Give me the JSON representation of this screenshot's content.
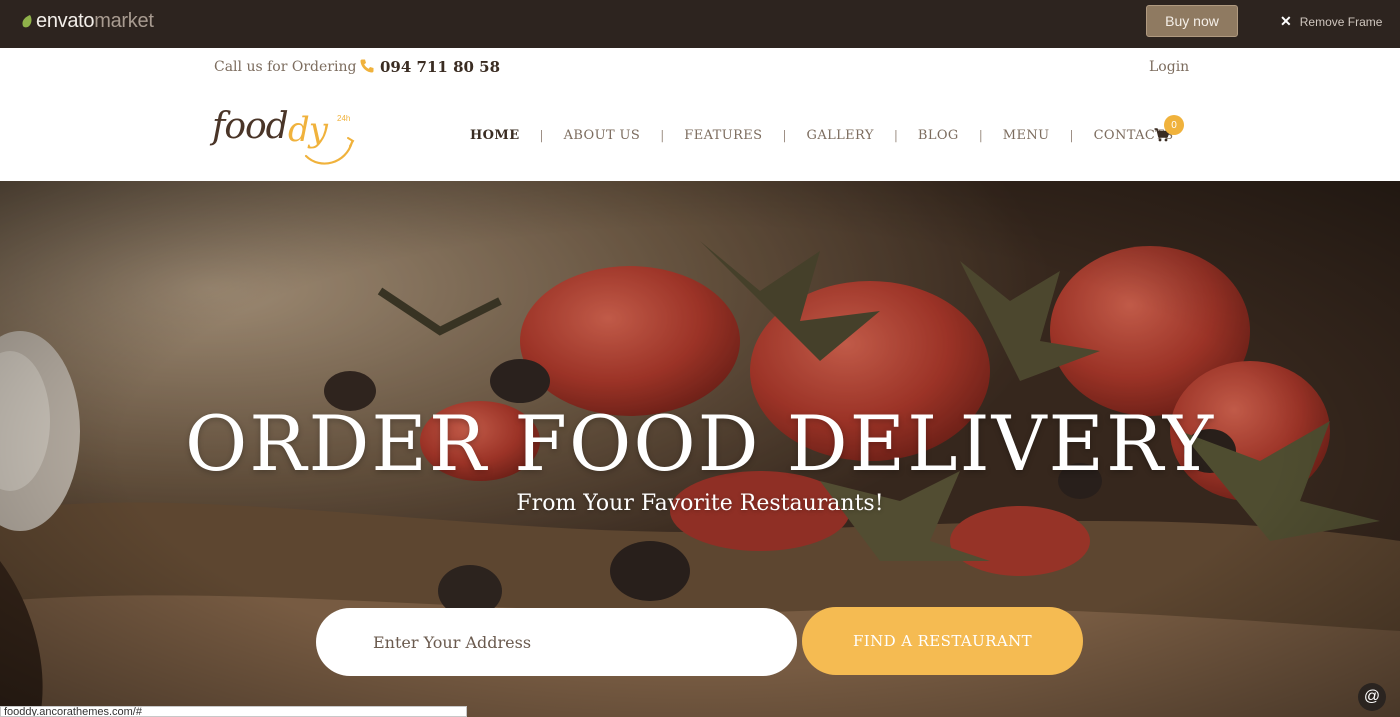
{
  "envato": {
    "brand_primary": "envato",
    "brand_secondary": "market",
    "buy_label": "Buy now",
    "remove_frame_label": "Remove Frame"
  },
  "contact": {
    "call_label": "Call us for Ordering",
    "phone": "094 711 80 58",
    "login_label": "Login"
  },
  "logo": {
    "part1": "food",
    "part2": "dy",
    "badge": "24h"
  },
  "nav": {
    "items": [
      {
        "label": "HOME",
        "active": true
      },
      {
        "label": "ABOUT US"
      },
      {
        "label": "FEATURES"
      },
      {
        "label": "GALLERY"
      },
      {
        "label": "BLOG"
      },
      {
        "label": "MENU"
      },
      {
        "label": "CONTACTS"
      }
    ],
    "separator": "|",
    "cart_count": "0"
  },
  "hero": {
    "title": "ORDER FOOD DELIVERY",
    "subtitle": "From Your Favorite Restaurants!",
    "address_placeholder": "Enter Your Address",
    "find_button": "FIND A RESTAURANT"
  },
  "floating": {
    "at_label": "@"
  },
  "status_bar": {
    "url": "fooddy.ancorathemes.com/#"
  },
  "colors": {
    "accent": "#f5bb52",
    "dark_brown": "#2d241f",
    "text_brown": "#7c6c5e"
  }
}
